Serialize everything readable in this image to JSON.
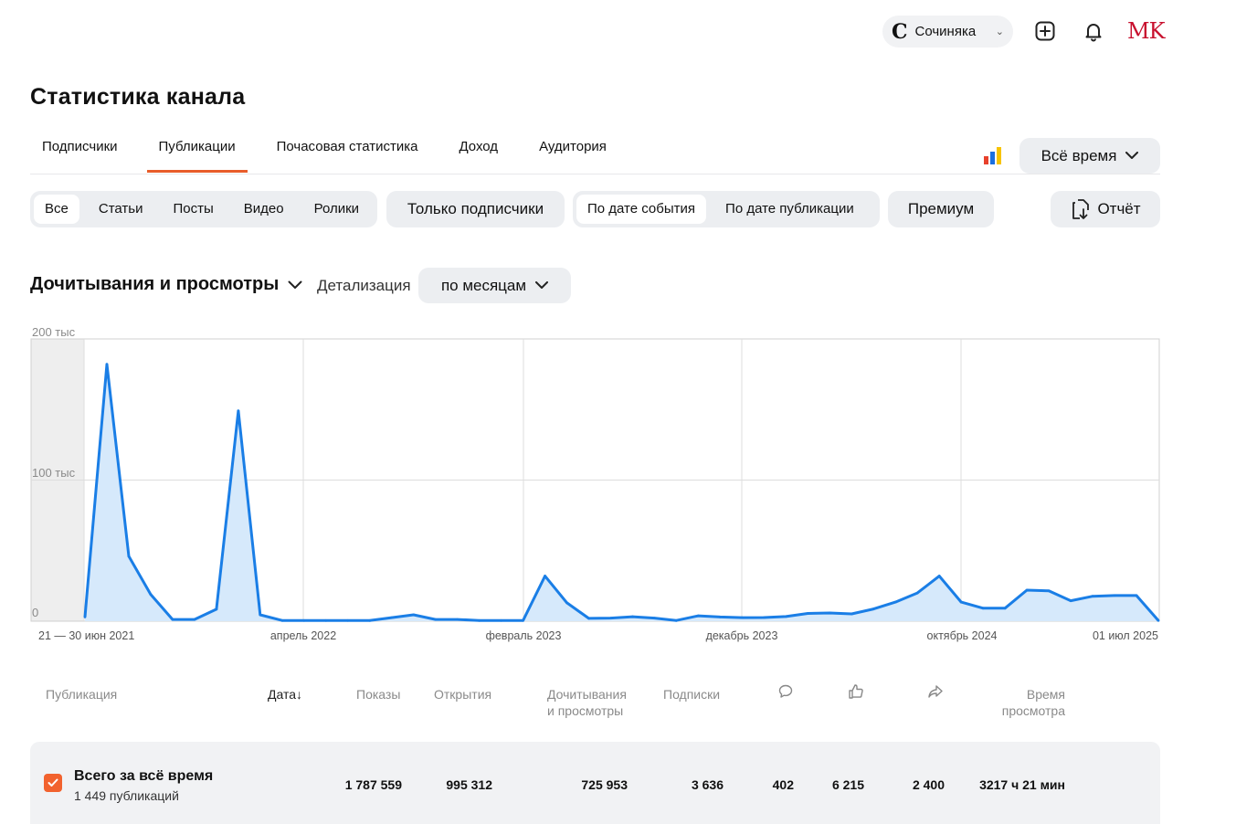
{
  "header": {
    "channel_name": "Сочиняка",
    "channel_logo_letter": "C",
    "avatar_text": "MK",
    "icons": [
      "plus-square-icon",
      "bell-icon"
    ]
  },
  "page_title": "Статистика канала",
  "tabs": [
    {
      "label": "Подписчики",
      "active": false
    },
    {
      "label": "Публикации",
      "active": true
    },
    {
      "label": "Почасовая статистика",
      "active": false
    },
    {
      "label": "Доход",
      "active": false
    },
    {
      "label": "Аудитория",
      "active": false
    }
  ],
  "period_button": "Всё время",
  "content_filter": [
    "Все",
    "Статьи",
    "Посты",
    "Видео",
    "Ролики"
  ],
  "content_filter_selected": "Все",
  "subscribers_only": "Только подписчики",
  "date_mode": [
    "По дате события",
    "По дате публикации"
  ],
  "date_mode_selected": "По дате события",
  "premium": "Премиум",
  "report": "Отчёт",
  "metric_selector": "Дочитывания и просмотры",
  "detail_label": "Детализация",
  "detail_value": "по месяцам",
  "chart_data": {
    "type": "area",
    "y_tick_labels": [
      "200 тыс",
      "100 тыс",
      "0"
    ],
    "y_ticks": [
      200000,
      100000,
      0
    ],
    "ylim": [
      0,
      200000
    ],
    "x_tick_labels": [
      "21 — 30 июн 2021",
      "апрель 2022",
      "февраль 2023",
      "декабрь 2023",
      "октябрь 2024",
      "01 июл 2025"
    ],
    "grid": true,
    "color": "#1a7ee6",
    "fill": "#d6e9fb",
    "values": [
      3000,
      182000,
      46000,
      19000,
      1200,
      1200,
      8500,
      149000,
      4500,
      500,
      500,
      500,
      500,
      500,
      2500,
      4500,
      1200,
      1200,
      500,
      500,
      500,
      32000,
      13000,
      2000,
      2200,
      3200,
      2200,
      500,
      3800,
      3000,
      2500,
      2600,
      3300,
      5500,
      5800,
      5200,
      8700,
      13500,
      20000,
      32000,
      13500,
      9200,
      9200,
      22000,
      21500,
      14500,
      17700,
      18200,
      18200,
      500
    ]
  },
  "table": {
    "headers": {
      "publication": "Публикация",
      "date": "Дата",
      "impressions": "Показы",
      "opens": "Открытия",
      "reads_line1": "Дочитывания",
      "reads_line2": "и просмотры",
      "subs": "Подписки",
      "watch_line1": "Время",
      "watch_line2": "просмотра"
    },
    "totals": {
      "title": "Всего за всё время",
      "subtitle": "1 449 публикаций",
      "impressions": "1 787 559",
      "opens": "995 312",
      "reads": "725 953",
      "subs": "3 636",
      "comments": "402",
      "likes": "6 215",
      "shares": "2 400",
      "watch_time": "3217 ч 21 мин"
    }
  }
}
